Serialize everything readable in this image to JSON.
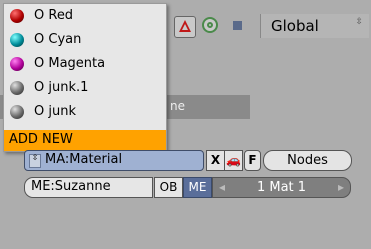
{
  "toolbar": {
    "scope_value": "Global",
    "scope_arrows": "⇳"
  },
  "panel": {
    "header_fragment": "ne"
  },
  "material_menu": {
    "items": [
      {
        "label": "O Red",
        "color": "#b00000"
      },
      {
        "label": "O Cyan",
        "color": "#008c99"
      },
      {
        "label": "O Magenta",
        "color": "#b0009a"
      },
      {
        "label": "O junk.1",
        "color": "#6a6a6a"
      },
      {
        "label": "O junk",
        "color": "#6a6a6a"
      }
    ],
    "add_new": "ADD NEW",
    "highlight_color": "#ffa200"
  },
  "material_row": {
    "selector_icon": "⇳",
    "material_name": "MA:Material",
    "delete_label": "X",
    "car_icon": "🚗",
    "fake_user_label": "F",
    "nodes_label": "Nodes"
  },
  "mesh_row": {
    "mesh_name": "ME:Suzanne",
    "ob_label": "OB",
    "me_label": "ME",
    "mat_index": "1 Mat 1",
    "left_arrow": "◂",
    "right_arrow": "▸"
  }
}
